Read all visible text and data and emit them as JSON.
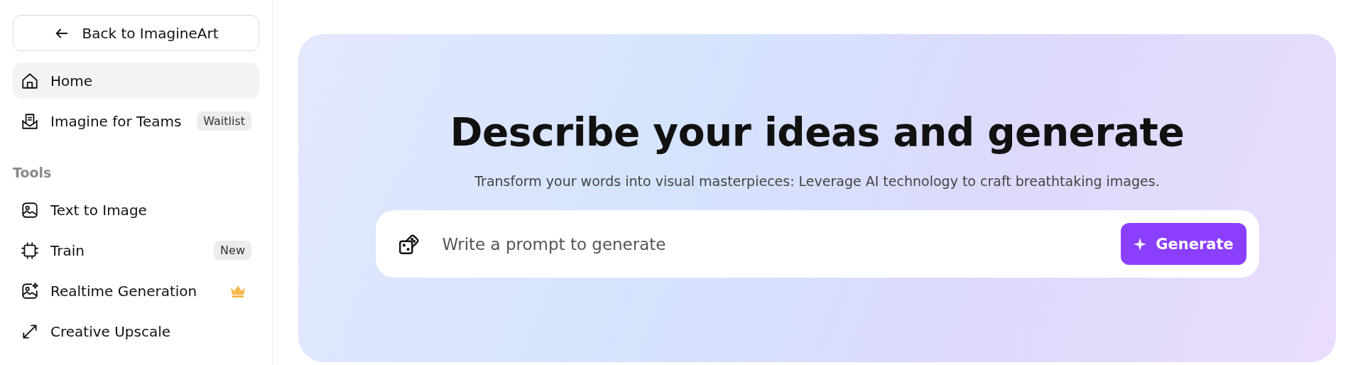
{
  "sidebar": {
    "back_button": "Back to ImagineArt",
    "items": [
      {
        "label": "Home",
        "selected": true
      },
      {
        "label": "Imagine for Teams",
        "selected": false,
        "badge": "Waitlist"
      }
    ],
    "section_title": "Tools",
    "tools": [
      {
        "label": "Text to Image",
        "selected": false,
        "premium": false
      },
      {
        "label": "Train",
        "selected": false,
        "premium": false,
        "badge": "New"
      },
      {
        "label": "Realtime Generation",
        "selected": false,
        "premium": true
      },
      {
        "label": "Creative Upscale",
        "selected": false,
        "premium": false
      }
    ]
  },
  "hero": {
    "title": "Describe your ideas and generate",
    "subtitle": "Transform your words into visual masterpieces: Leverage AI technology to craft breathtaking images.",
    "prompt": {
      "placeholder": "Write a prompt to generate"
    },
    "generate_button": "Generate"
  }
}
